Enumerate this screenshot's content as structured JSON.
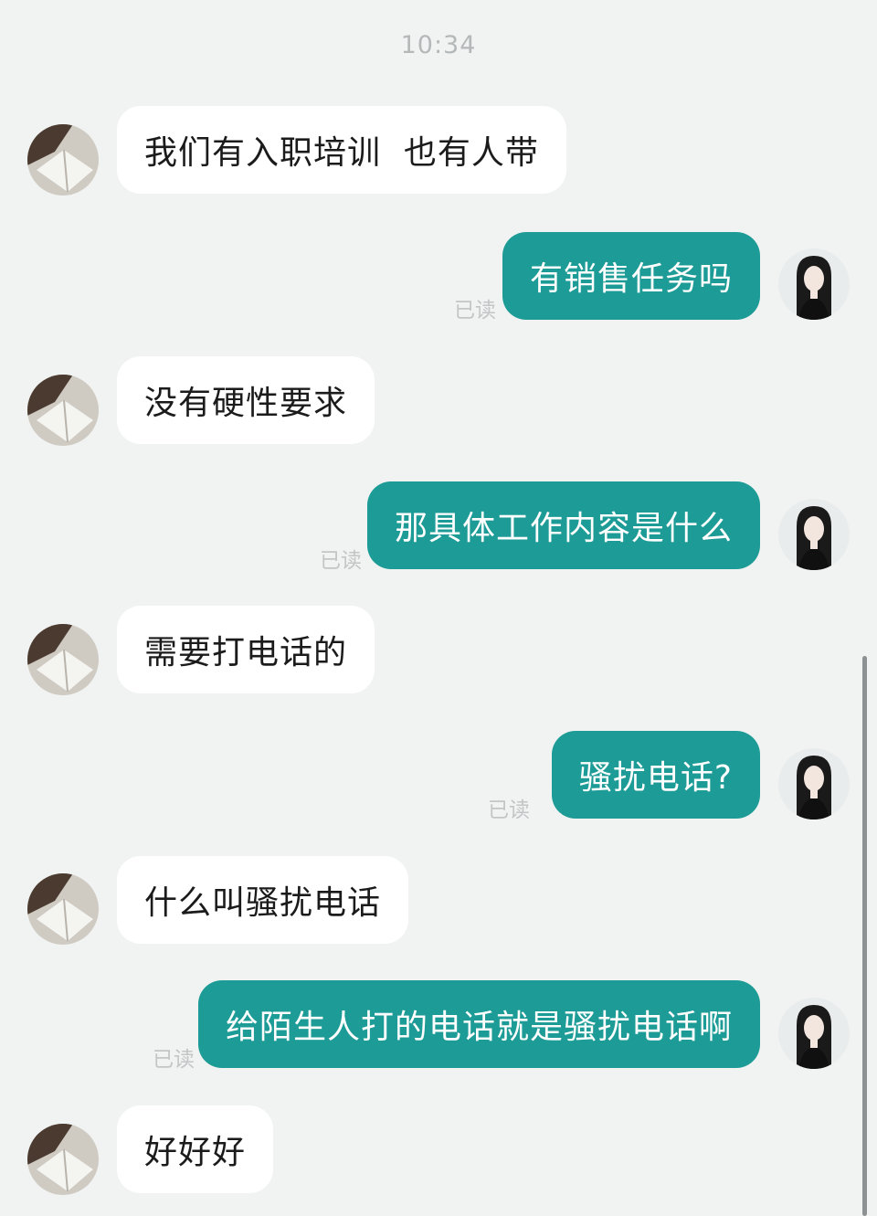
{
  "time": "10:34",
  "messages": [
    {
      "side": "in",
      "text": "我们有入职培训  也有人带"
    },
    {
      "side": "out",
      "text": "有销售任务吗",
      "status": "已读"
    },
    {
      "side": "in",
      "text": "没有硬性要求"
    },
    {
      "side": "out",
      "text": "那具体工作内容是什么",
      "status": "已读"
    },
    {
      "side": "in",
      "text": "需要打电话的"
    },
    {
      "side": "out",
      "text": "骚扰电话?",
      "status": "已读"
    },
    {
      "side": "in",
      "text": "什么叫骚扰电话"
    },
    {
      "side": "out",
      "text": "给陌生人打的电话就是骚扰电话啊",
      "status": "已读"
    },
    {
      "side": "in",
      "text": "好好好"
    }
  ],
  "colors": {
    "background": "#f1f3f2",
    "incoming_bubble": "#ffffff",
    "outgoing_bubble": "#1d9b96",
    "read_status": "#c3c6c6"
  },
  "icons": {
    "contact_avatar": "book-avatar-icon",
    "user_avatar": "woman-avatar-icon"
  }
}
